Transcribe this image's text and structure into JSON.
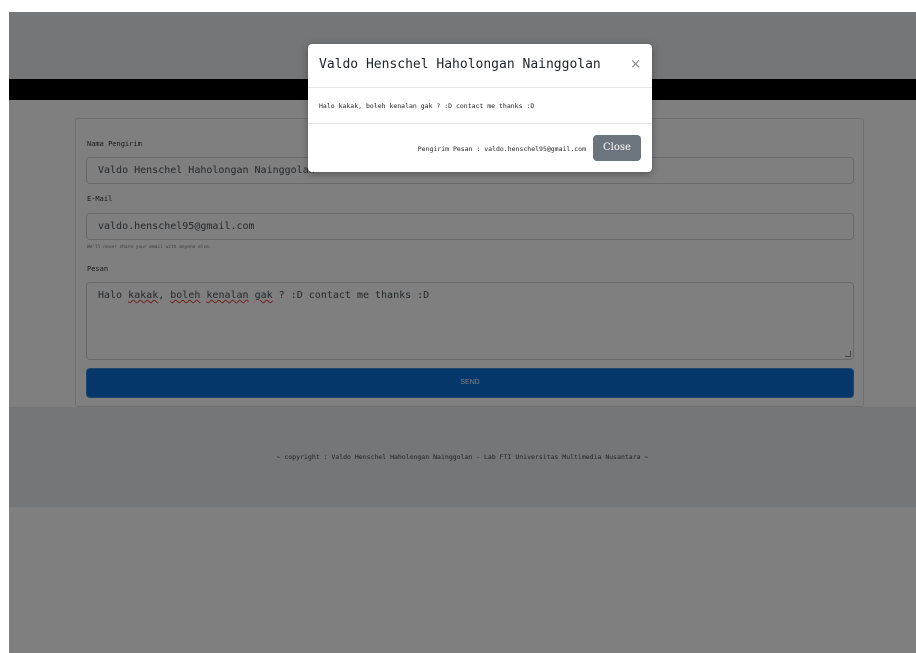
{
  "form": {
    "name_label": "Nama Pengirim",
    "name_value": "Valdo Henschel Haholongan Nainggolan",
    "email_label": "E-Mail",
    "email_value": "valdo.henschel95@gmail.com",
    "email_help": "We'll never share your email with anyone else.",
    "message_label": "Pesan",
    "message_parts": [
      "Halo ",
      "kakak",
      ", ",
      "boleh",
      " ",
      "kenalan",
      " ",
      "gak",
      " ? :D contact me thanks :D"
    ],
    "send_label": "SEND"
  },
  "footer": {
    "text": "~ copyright : Valdo Henschel Haholongan Nainggolan - Lab FTI Universitas Multimedia Nusantara ~"
  },
  "modal": {
    "title": "Valdo Henschel Haholongan Nainggolan",
    "close_glyph": "×",
    "message": "Halo kakak, boleh kenalan gak ? :D contact me thanks :D",
    "sender_line": "Pengirim Pesan : valdo.henschel95@gmail.com",
    "close_label": "Close"
  },
  "colors": {
    "send_button": "#0a6fd6",
    "close_button": "#6c757d",
    "navbar": "#000000",
    "backdrop": "rgba(0,0,0,0.5)"
  }
}
